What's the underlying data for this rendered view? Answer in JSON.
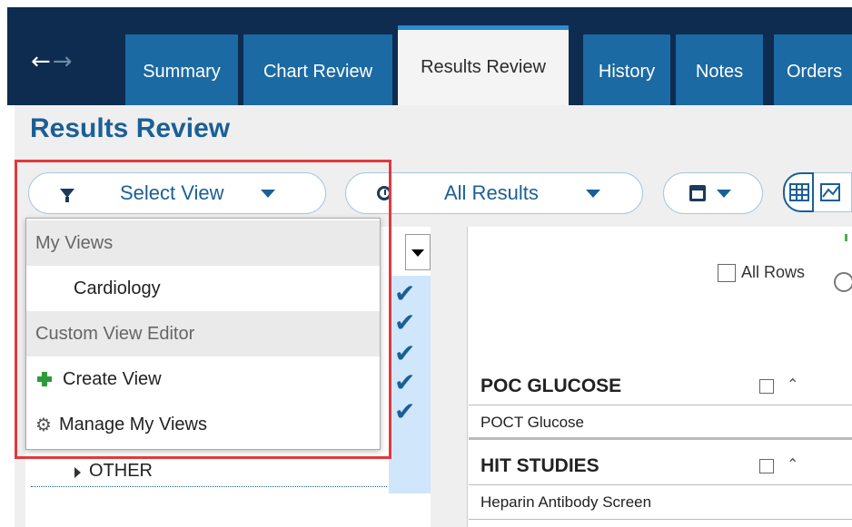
{
  "nav": {
    "back_glyph": "←",
    "forward_glyph": "→"
  },
  "tabs": [
    {
      "label": "Summary"
    },
    {
      "label": "Chart Review"
    },
    {
      "label": "Results Review"
    },
    {
      "label": "History"
    },
    {
      "label": "Notes"
    },
    {
      "label": "Orders"
    }
  ],
  "page": {
    "title": "Results Review"
  },
  "toolbar": {
    "select_view_label": "Select View",
    "results_filter_label": "All Results"
  },
  "dropdown": {
    "group_my_views": "My Views",
    "item_cardiology": "Cardiology",
    "group_custom_editor": "Custom View Editor",
    "item_create_view": "Create View",
    "item_manage_views": "Manage My Views"
  },
  "tree": {
    "other_label": "OTHER"
  },
  "results": {
    "all_rows_label": "All Rows",
    "sections": [
      {
        "header": "POC GLUCOSE",
        "item": "POCT Glucose"
      },
      {
        "header": "HIT STUDIES",
        "item": "Heparin Antibody Screen"
      }
    ]
  },
  "icons": {
    "filter": "funnel-icon",
    "clock": "clock-icon",
    "calendar": "calendar-icon",
    "grid": "grid-view-icon",
    "graph": "graph-view-icon",
    "create": "plus-icon",
    "manage": "gears-icon"
  },
  "colors": {
    "topbar": "#0d2c4f",
    "tab": "#1b6aa3",
    "accent": "#1b5f96",
    "highlight": "#e0393e",
    "checked_bg": "#cfe6fb"
  }
}
